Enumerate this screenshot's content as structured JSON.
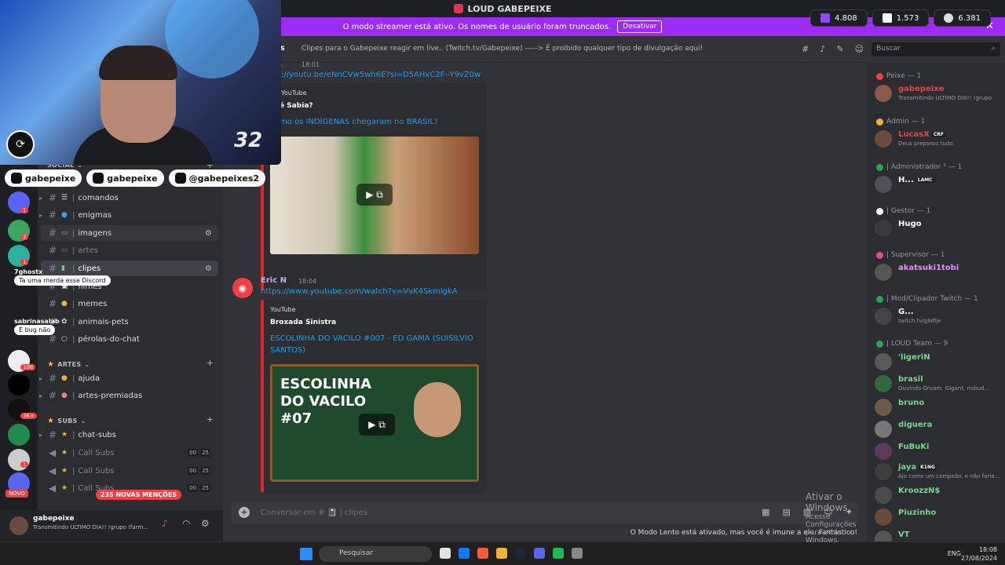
{
  "window": {
    "title": "LOUD GABEPEIXE"
  },
  "banner": {
    "text": "O modo streamer está ativo. Os nomes de usuário foram truncados.",
    "button": "Desativar",
    "close": "✕"
  },
  "counters": [
    {
      "icon": "twitch-icon",
      "value": "4.808"
    },
    {
      "icon": "kick-icon",
      "value": "1.573"
    },
    {
      "icon": "globe-icon",
      "value": "6.381"
    }
  ],
  "webcam": {
    "number": "32",
    "circle_glyph": "⟳"
  },
  "socials": [
    {
      "icon": "youtube-icon",
      "handle": "gabepeixe"
    },
    {
      "icon": "instagram-icon",
      "handle": "gabepeixe"
    },
    {
      "icon": "tiktok-icon",
      "handle": "@gabepeixes2"
    }
  ],
  "toasts": [
    {
      "user": "7ghostx",
      "message": "Ta uma merda esse Discord"
    },
    {
      "user": "sabrinasalab",
      "message": "É bug não"
    }
  ],
  "rail": {
    "novo": "NOVO",
    "badges": [
      "1",
      "2",
      "1",
      "108",
      "3K+",
      "1",
      "1",
      "1"
    ]
  },
  "sidebar": {
    "categories": [
      {
        "name": "SOCIAL",
        "symbol": "⌄"
      },
      {
        "name": "ARTES",
        "symbol": "⌄"
      },
      {
        "name": "SUBS",
        "symbol": "⌄"
      }
    ],
    "social_channels": [
      {
        "label": "cha",
        "sep": "|"
      },
      {
        "label": "comandos",
        "sep": "|"
      },
      {
        "label": "enigmas",
        "sep": "|"
      },
      {
        "label": "imagens",
        "sep": "|"
      },
      {
        "label": "artes",
        "sep": "|"
      },
      {
        "label": "clipes",
        "sep": "|"
      },
      {
        "label": "filmes",
        "sep": "|"
      },
      {
        "label": "memes",
        "sep": "|"
      },
      {
        "label": "animais-pets",
        "sep": "|"
      },
      {
        "label": "pérolas-do-chat",
        "sep": "|"
      }
    ],
    "art_channels": [
      {
        "label": "ajuda",
        "sep": "|"
      },
      {
        "label": "artes-premiadas",
        "sep": "|"
      }
    ],
    "sub_channels": [
      {
        "label": "chat-subs",
        "sep": "|"
      },
      {
        "label": "Call Subs",
        "sep": "|",
        "a": "00",
        "b": "25"
      },
      {
        "label": "Call Subs",
        "sep": "|",
        "a": "00",
        "b": "25"
      },
      {
        "label": "Call Subs",
        "sep": "|",
        "a": "00",
        "b": "25"
      }
    ],
    "mentions": "235 NOVAS MENÇÕES"
  },
  "user": {
    "name": "gabepeixe",
    "status": "Transmitindo ULTIMO DIA!! !grupo !farm..."
  },
  "channel": {
    "name": "clipes",
    "name_fragment": "es",
    "topic": "Clipes para o Gabepeixe reagir em live.. (Twitch.tv/Gabepeixe) -----> É proibido qualquer tipo de divulgação aqui!"
  },
  "search": {
    "placeholder": "Buscar"
  },
  "messages": [
    {
      "time": "18:01",
      "author_fragment": "3.",
      "url": "://youtu.be/eNnCVw5wh6E?si=D5AHxC2F--Y9vZ0w",
      "provider": "YouTube",
      "embed_author": "é Sabia?",
      "embed_title": "mo os INDÍGENAS chegaram no BRASIL?"
    },
    {
      "author": "Eric N",
      "time": "18:04",
      "url": "https://www.youtube.com/watch?v=VvK4SkmlgkA",
      "provider": "YouTube",
      "embed_author": "Broxada Sinistra",
      "embed_title": "ESCOLINHA DO VACILO #007 - ED GAMA (SUISILVIO SANTOS)",
      "thumb_text": "ESCOLINHA DO VACILO #07"
    }
  ],
  "composer": {
    "placeholder": "Conversar em # 📓 | clipes"
  },
  "slowmode": "O Modo Lento está ativado, mas você é imune a ele. Fantástico!",
  "activate_windows": {
    "title": "Ativar o Windows",
    "subtitle": "Acesse Configurações para ativar o Windows."
  },
  "members": {
    "roles": [
      {
        "label": "Peixe — 1",
        "color": "#f23f43"
      },
      {
        "label": "Admin — 1",
        "color": "#f0b232"
      },
      {
        "label": "| Administrador ² — 1",
        "color": "#23a55a"
      },
      {
        "label": "| Gestor — 1",
        "color": "#ffffff"
      },
      {
        "label": "| Supervisor — 1",
        "color": "#eb459f"
      },
      {
        "label": "| Mod/Clipador Twitch — 1",
        "color": "#23a55a"
      },
      {
        "label": "| LOUD Team — 9",
        "color": "#23a55a"
      }
    ],
    "list": [
      {
        "name": "gabepeixe",
        "color": "#f23f43",
        "status": "Transmitindo ULTIMO DIA!! !grupo"
      },
      {
        "name": "LucasX",
        "color": "#f23f43",
        "tag": "CRF",
        "status": "Deus preparou tudo."
      },
      {
        "name": "H...",
        "color": "#ffffff",
        "tag": "LAMC",
        "status": ""
      },
      {
        "name": "Hugo",
        "color": "#ffffff",
        "status": ""
      },
      {
        "name": "akatsuki1tobi",
        "color": "#eb8bff",
        "status": ""
      },
      {
        "name": "G...",
        "color": "#ffffff",
        "status": "twitch.tv/gloffje"
      },
      {
        "name": "'ligeriN",
        "color": "#6fdc8c",
        "status": ""
      },
      {
        "name": "brasil",
        "color": "#6fdc8c",
        "status": "Ouvindo Oruam, Gigant, nobud..."
      },
      {
        "name": "bruno",
        "color": "#6fdc8c",
        "status": ""
      },
      {
        "name": "diguera",
        "color": "#6fdc8c",
        "status": ""
      },
      {
        "name": "FuBuKi",
        "color": "#6fdc8c",
        "status": ""
      },
      {
        "name": "jaya",
        "color": "#6fdc8c",
        "tag": "K1NG",
        "status": "Ajo como um campeão, e não faria..."
      },
      {
        "name": "KroozzN$",
        "color": "#6fdc8c",
        "status": ""
      },
      {
        "name": "Piuzinho",
        "color": "#6fdc8c",
        "status": ""
      },
      {
        "name": "VT",
        "color": "#6fdc8c",
        "status": ""
      }
    ]
  },
  "taskbar": {
    "search": "Pesquisar",
    "lang": "ENG",
    "time": "18:08",
    "date": "27/08/2024"
  }
}
